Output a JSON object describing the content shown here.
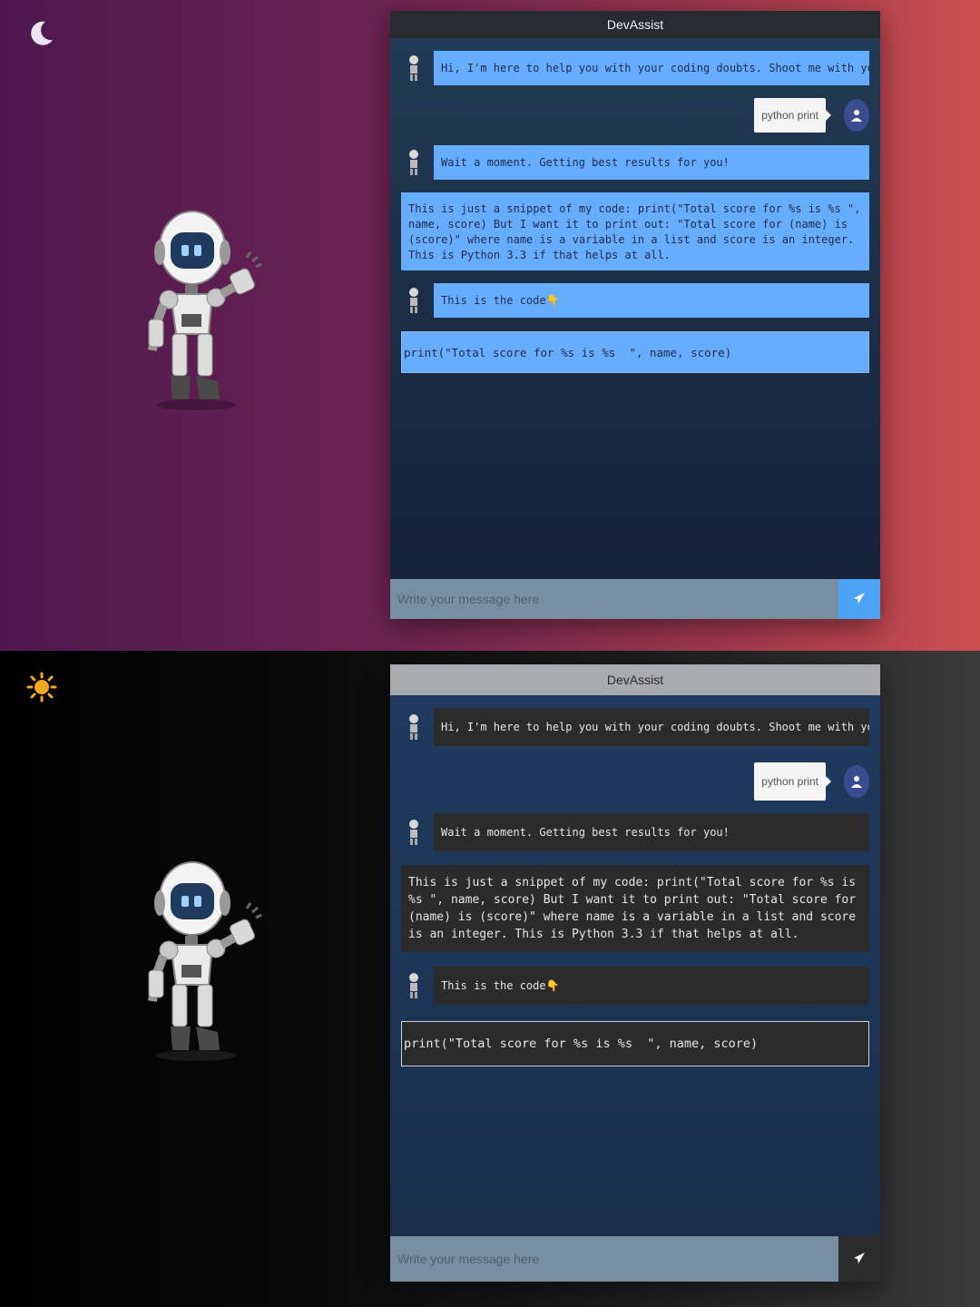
{
  "light": {
    "theme_icon": "moon-icon",
    "header_title": "DevAssist",
    "messages": {
      "greeting": "Hi, I'm here to help you with your coding doubts. Shoot me with your doubts?",
      "user_query": "python print",
      "wait": "Wait a moment. Getting best results for you!",
      "snippet": "This is just a snippet of my code: print(\"Total score for %s is %s \", name, score) But I want it to print out: \"Total score for (name) is (score)\" where name is a variable in a list and score is an integer. This is Python 3.3 if that helps at all.",
      "code_intro": "This is the code👇",
      "code": "print(\"Total score for %s is %s  \", name, score)"
    },
    "input": {
      "placeholder": "Write your message here"
    },
    "colors": {
      "bubble": "#66adff",
      "accent": "#4aa3f5"
    }
  },
  "dark": {
    "theme_icon": "sun-icon",
    "header_title": "DevAssist",
    "messages": {
      "greeting": "Hi, I'm here to help you with your coding doubts. Shoot me with your doubts?",
      "user_query": "python print",
      "wait": "Wait a moment. Getting best results for you!",
      "snippet": "This is just a snippet of my code: print(\"Total score for %s is %s \", name, score) But I want it to print out: \"Total score for (name) is (score)\" where name is a variable in a list and score is an integer. This is Python 3.3 if that helps at all.",
      "code_intro": "This is the code👇",
      "code": "print(\"Total score for %s is %s  \", name, score)"
    },
    "input": {
      "placeholder": "Write your message here"
    },
    "colors": {
      "bubble": "#2b2b2b",
      "accent": "#f5a623"
    }
  }
}
